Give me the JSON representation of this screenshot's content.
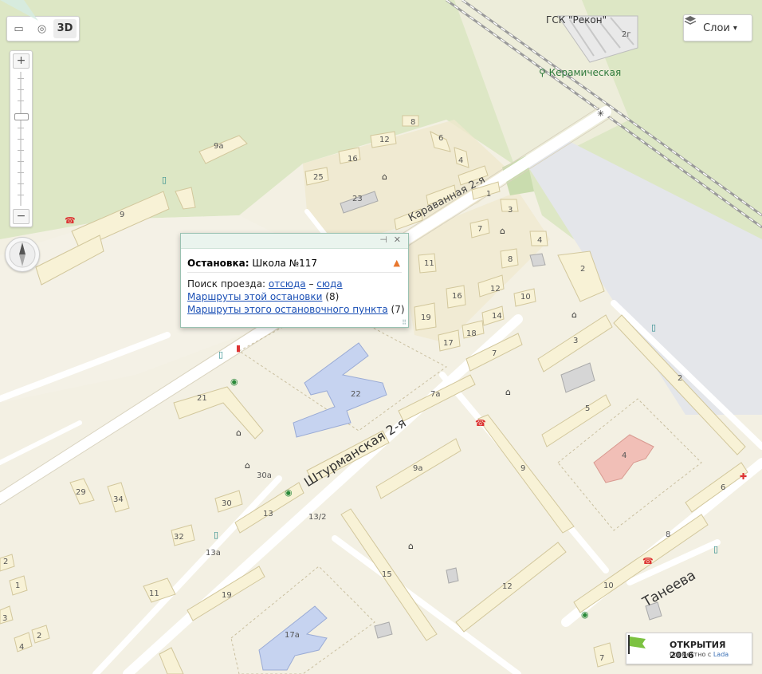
{
  "map": {
    "street_labels": {
      "karavannaya": "Караванная 2-я",
      "shturmanskaya": "Штурманская 2-я",
      "taneeva": "Танеева"
    },
    "poi_labels": {
      "gsk": "ГСК \"Рекон\"",
      "keramicheskaya": "Керамическая"
    },
    "house_numbers": {
      "h2g": "2г",
      "h9a_top": "9а",
      "h9": "9",
      "h8": "8",
      "h12_top": "12",
      "h6_top": "6",
      "h16_top": "16",
      "h4_top": "4",
      "h25": "25",
      "h23": "23",
      "h1": "1",
      "h3_top": "3",
      "h7_top": "7",
      "h4_b": "4",
      "h11": "11",
      "h8_b": "8",
      "h2_right": "2",
      "h12_mid": "12",
      "h16_mid": "16",
      "h10_mid": "10",
      "h19": "19",
      "h14": "14",
      "h17": "17",
      "h18": "18",
      "h7_mid": "7",
      "h3_mid": "3",
      "h2_far": "2",
      "h22": "22",
      "h7a": "7а",
      "h21": "21",
      "h5": "5",
      "h4_school": "4",
      "h9a_mid": "9а",
      "h9_mid": "9",
      "h6_right": "6",
      "h30a": "30а",
      "h29": "29",
      "h34": "34",
      "h30": "30",
      "h13": "13",
      "h13_2": "13/2",
      "h8_right": "8",
      "h32": "32",
      "h13a": "13а",
      "h15": "15",
      "h12_low": "12",
      "h10_low": "10",
      "h11_low": "11",
      "h19_low": "19",
      "h17a": "17а",
      "h2_left": "2",
      "h1_left": "1",
      "h3_left": "3",
      "h4_left": "4",
      "h2_left2": "2",
      "h7_low": "7"
    }
  },
  "controls": {
    "tools": {
      "ruler_icon": "ruler-icon",
      "traffic_icon": "traffic-icon",
      "threed": "3D"
    },
    "zoom": {
      "plus": "+",
      "minus": "−"
    },
    "layers": {
      "label": "Слои",
      "arrow": "▾"
    }
  },
  "popup": {
    "title_bold": "Остановка:",
    "title_value": "Школа №117",
    "search_label": "Поиск проезда:",
    "link_from": "отсюда",
    "dash": "–",
    "link_to": "сюда",
    "routes_stop": "Маршруты этой остановки",
    "routes_stop_count": "(8)",
    "routes_point": "Маршруты этого остановочного пункта",
    "routes_point_count": "(7)"
  },
  "promo": {
    "title": "ОТКРЫТИЯ 2016",
    "subtitle": "Совместно с",
    "brand": "Lada"
  },
  "colors": {
    "grass": "#dde7c5",
    "land": "#f2efe2",
    "building": "#f7f1d4",
    "school": "#c6d3f0",
    "hospital": "#f1bfb7",
    "rail": "#9a9a9a",
    "road": "#ffffff",
    "parking": "#e5e6e8",
    "popup_border": "#9ac2b2"
  }
}
